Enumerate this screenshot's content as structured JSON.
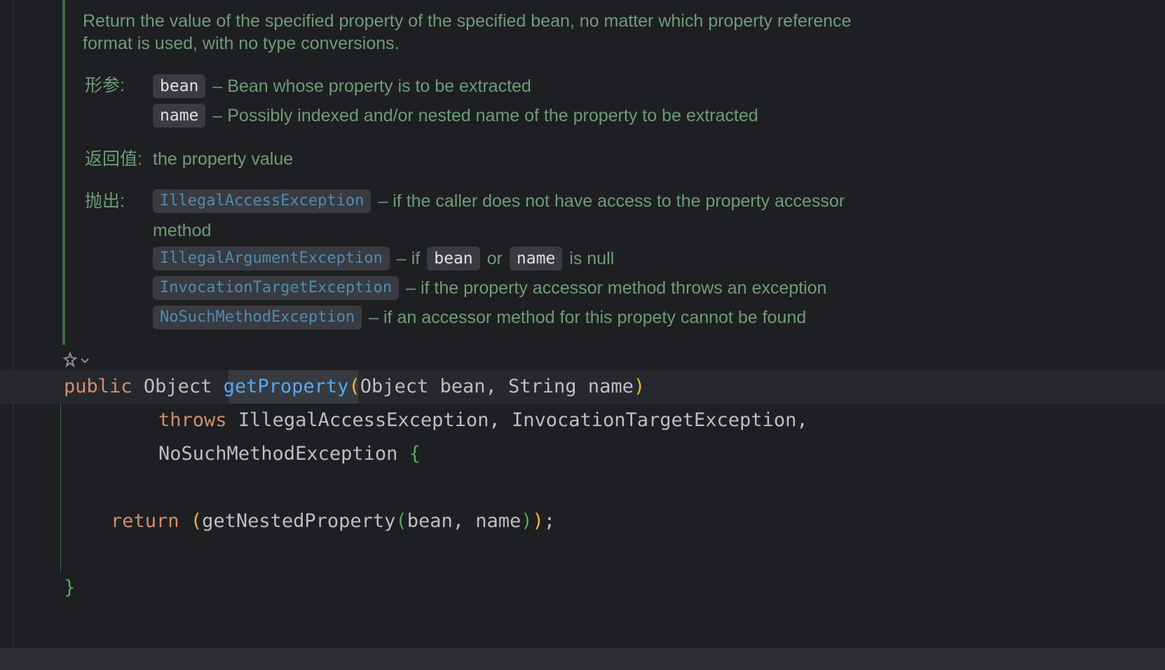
{
  "doc": {
    "description_line1": "Return the value of the specified property of the specified bean, no matter which property reference",
    "description_line2": "format is used, with no type conversions.",
    "params_label": "形参:",
    "params": [
      {
        "name": "bean",
        "desc": "– Bean whose property is to be extracted"
      },
      {
        "name": "name",
        "desc": "– Possibly indexed and/or nested name of the property to be extracted"
      }
    ],
    "returns_label": "返回值:",
    "returns_text": "the property value",
    "throws_label": "抛出:",
    "throws": [
      {
        "name": "IllegalAccessException",
        "desc": "– if the caller does not have access to the property accessor",
        "desc_cont": "method"
      },
      {
        "name": "IllegalArgumentException",
        "desc_prefix": "– if",
        "code1": "bean",
        "mid": "or",
        "code2": "name",
        "desc_suffix": "is null"
      },
      {
        "name": "InvocationTargetException",
        "desc": "– if the property accessor method throws an exception"
      },
      {
        "name": "NoSuchMethodException",
        "desc": "– if an accessor method for this propety cannot be found"
      }
    ]
  },
  "code": {
    "line1": {
      "kw": "public",
      "type": "Object",
      "method": "getProperty",
      "open": "(",
      "params": "Object bean, String name",
      "close": ")"
    },
    "line2": {
      "kw": "throws",
      "rest": "IllegalAccessException, InvocationTargetException,"
    },
    "line3": {
      "rest": "NoSuchMethodException",
      "brace": "{"
    },
    "line4": {
      "kw": "return",
      "open1": "(",
      "call": "getNestedProperty",
      "open2": "(",
      "args": "bean, name",
      "close2": ")",
      "close1": ")",
      "end": ";"
    },
    "line5": {
      "brace": "}"
    }
  },
  "icons": {
    "ai": "ai-assistant-icon",
    "chevron": "chevron-down-icon"
  },
  "colors": {
    "background": "#1e1f22",
    "doc_text": "#6e9b78",
    "keyword": "#cf8e6d",
    "method": "#56a8f5",
    "link": "#4f8bb0"
  }
}
